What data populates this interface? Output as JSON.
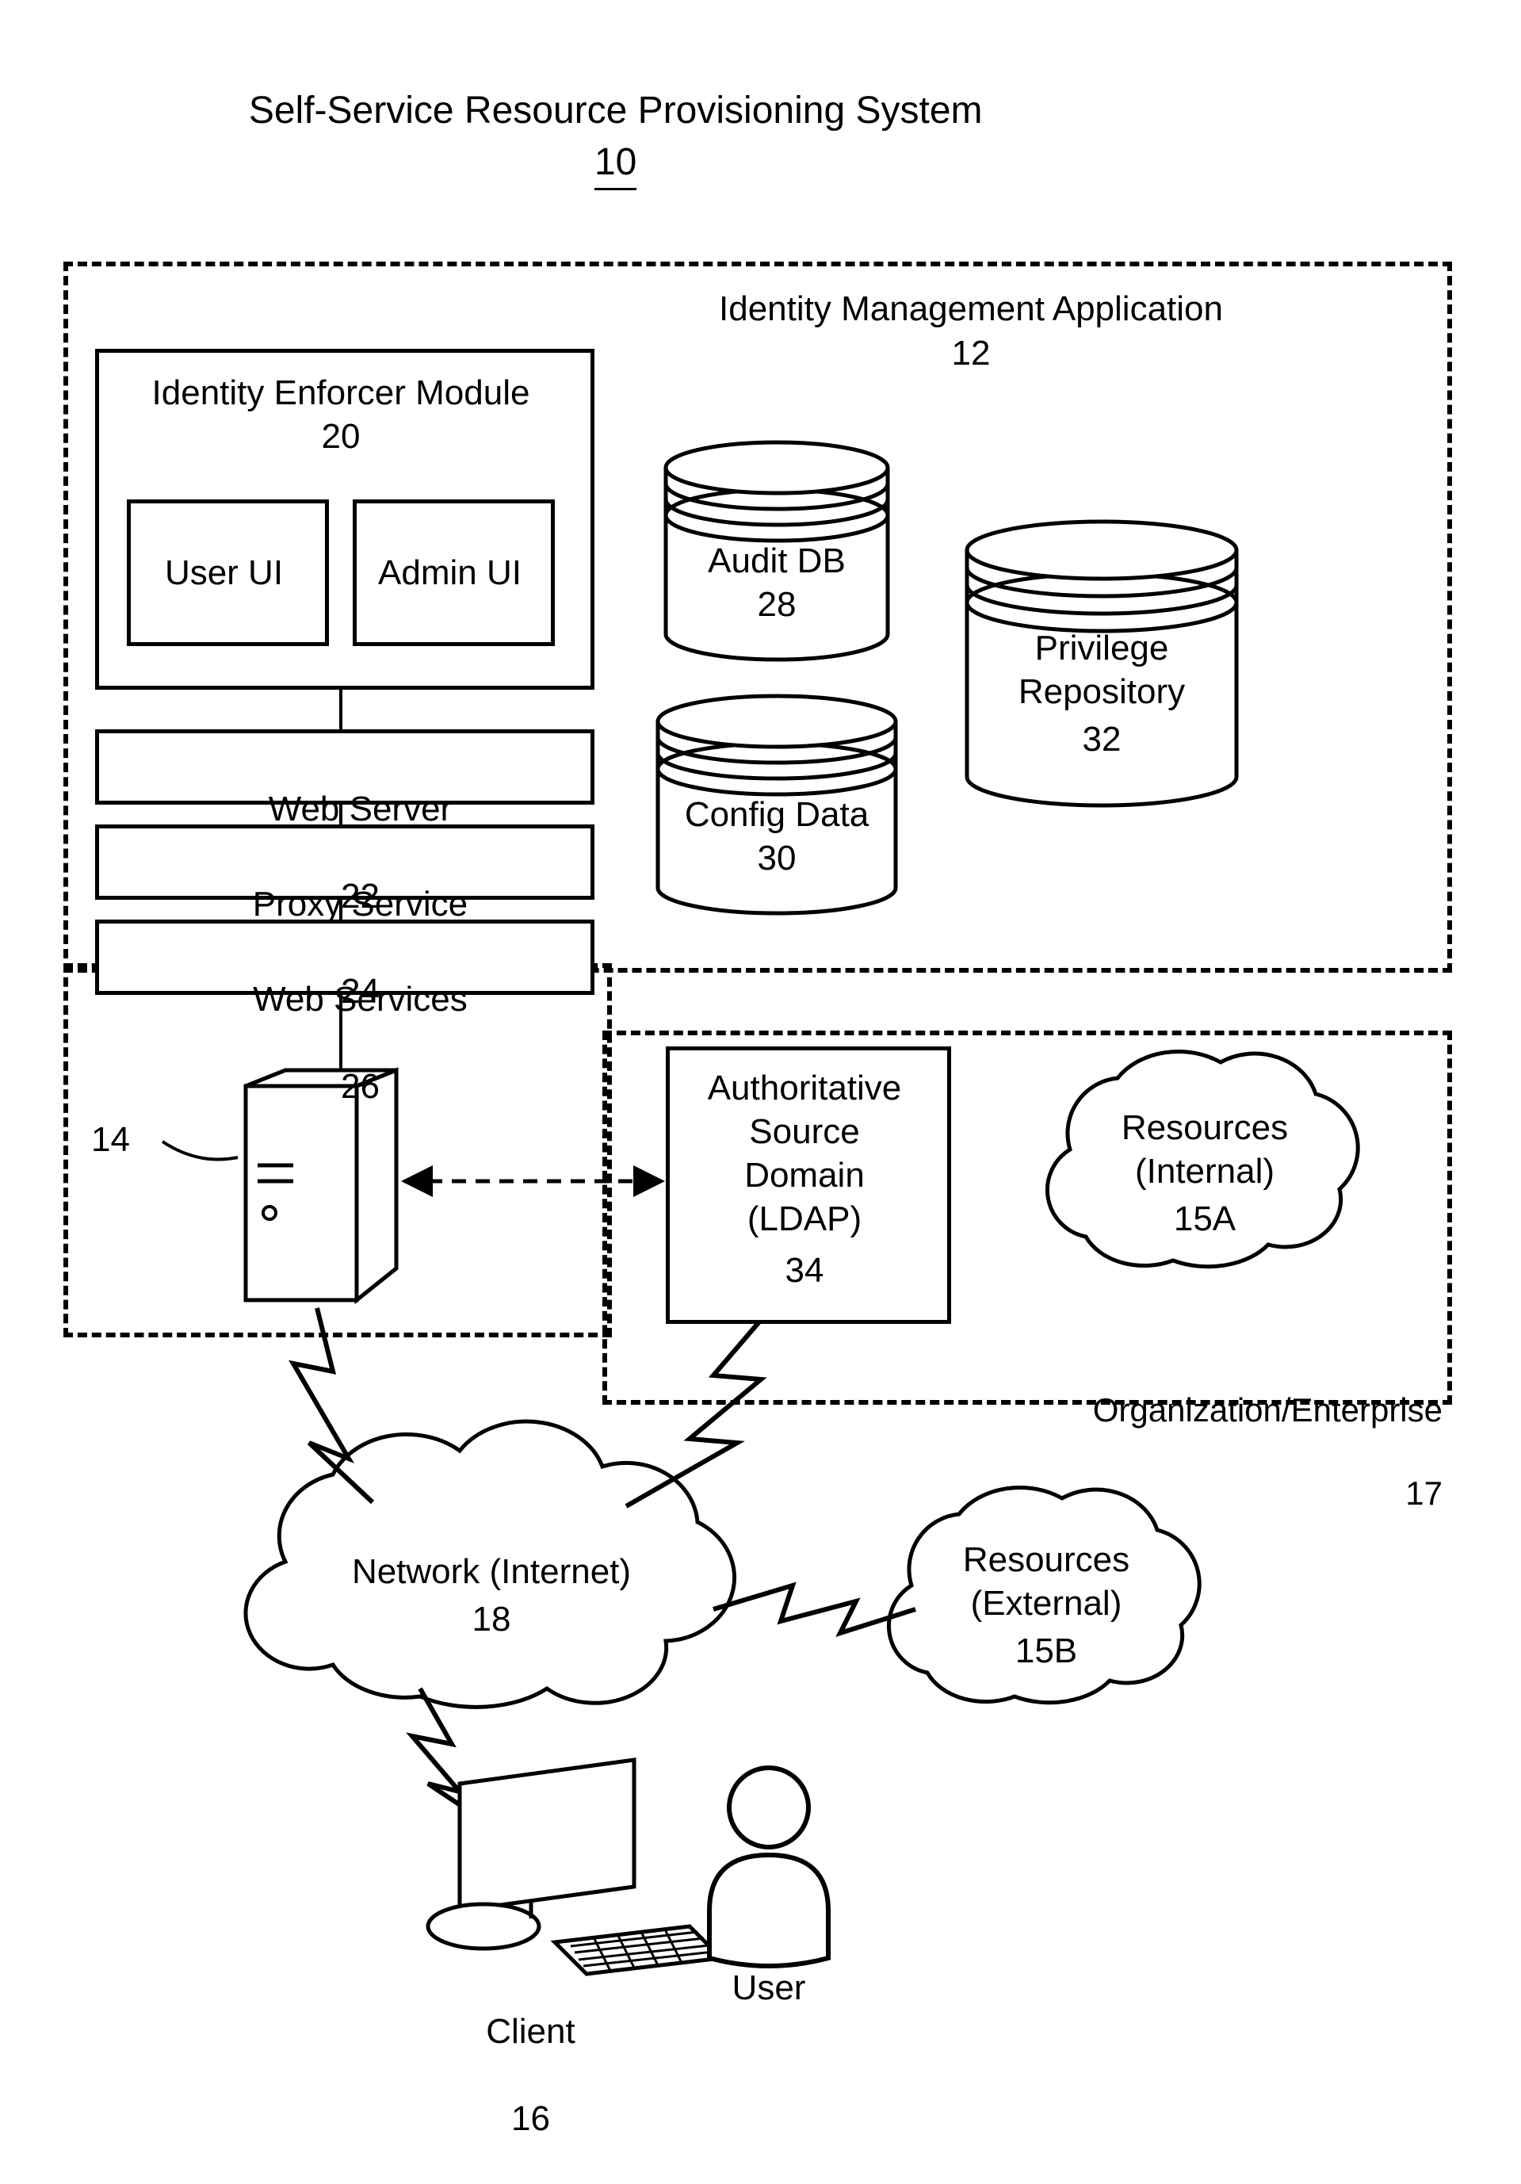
{
  "title": {
    "text": "Self-Service Resource Provisioning System",
    "ref": "10"
  },
  "ima": {
    "title": "Identity Management Application",
    "ref": "12"
  },
  "enforcer": {
    "title": "Identity Enforcer Module",
    "ref": "20",
    "user_ui": "User UI",
    "admin_ui": "Admin UI"
  },
  "web_server": {
    "label": "Web Server",
    "ref": "22"
  },
  "proxy_service": {
    "label": "Proxy Service",
    "ref": "24"
  },
  "web_services": {
    "label": "Web Services",
    "ref": "26"
  },
  "audit_db": {
    "label": "Audit DB",
    "ref": "28"
  },
  "config_data": {
    "label": "Config Data",
    "ref": "30"
  },
  "privilege_repo": {
    "label_line1": "Privilege",
    "label_line2": "Repository",
    "ref": "32"
  },
  "server_ref": "14",
  "asd": {
    "line1": "Authoritative",
    "line2": "Source",
    "line3": "Domain",
    "line4": "(LDAP)",
    "ref": "34"
  },
  "resources_internal": {
    "line1": "Resources",
    "line2": "(Internal)",
    "ref": "15A"
  },
  "org": {
    "label": "Organization/Enterprise",
    "ref": "17"
  },
  "network": {
    "line1": "Network (Internet)",
    "ref": "18"
  },
  "resources_external": {
    "line1": "Resources",
    "line2": "(External)",
    "ref": "15B"
  },
  "client": {
    "label": "Client",
    "ref": "16"
  },
  "user": {
    "label": "User"
  }
}
